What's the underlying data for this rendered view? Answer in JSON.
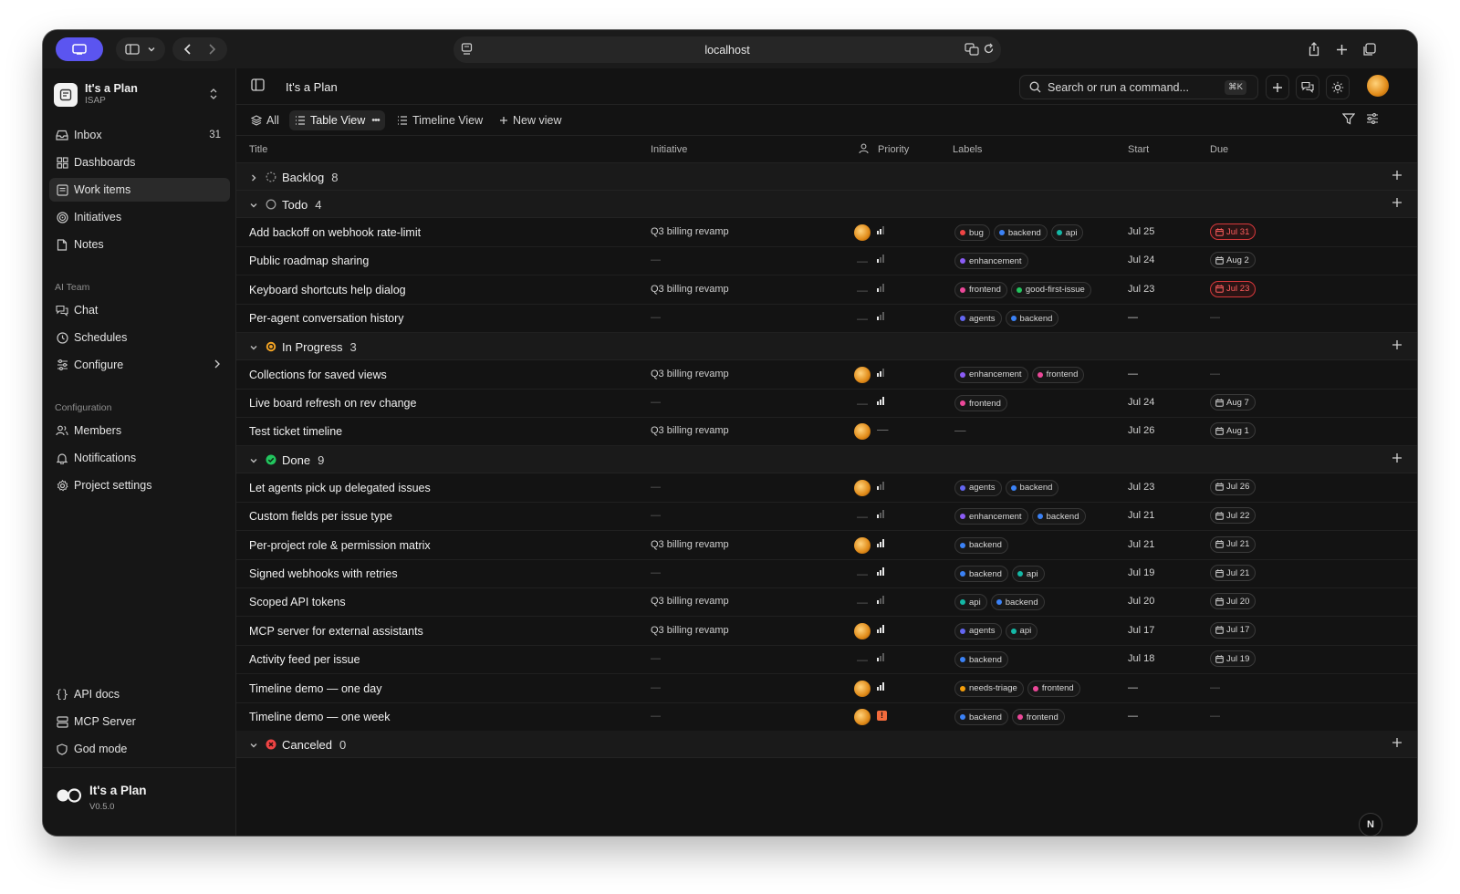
{
  "browser": {
    "url": "localhost"
  },
  "sidebar": {
    "workspace": {
      "name": "It's a Plan",
      "code": "ISAP"
    },
    "nav": [
      {
        "label": "Inbox",
        "count": "31",
        "icon": "inbox-icon"
      },
      {
        "label": "Dashboards",
        "icon": "dashboard-icon"
      },
      {
        "label": "Work items",
        "icon": "work-items-icon",
        "active": true
      },
      {
        "label": "Initiatives",
        "icon": "target-icon"
      },
      {
        "label": "Notes",
        "icon": "note-icon"
      }
    ],
    "ai_team": {
      "heading": "AI Team",
      "items": [
        {
          "label": "Chat",
          "icon": "chat-icon"
        },
        {
          "label": "Schedules",
          "icon": "clock-icon"
        },
        {
          "label": "Configure",
          "icon": "sliders-icon"
        }
      ]
    },
    "configuration": {
      "heading": "Configuration",
      "items": [
        {
          "label": "Members",
          "icon": "members-icon"
        },
        {
          "label": "Notifications",
          "icon": "bell-icon"
        },
        {
          "label": "Project settings",
          "icon": "gear-icon"
        }
      ]
    },
    "bottom": [
      {
        "label": "API docs",
        "icon": "braces-icon"
      },
      {
        "label": "MCP Server",
        "icon": "server-icon"
      },
      {
        "label": "God mode",
        "icon": "shield-icon"
      }
    ],
    "footer": {
      "app": "It's a Plan",
      "version": "V0.5.0"
    }
  },
  "header": {
    "title": "It's a Plan",
    "search_placeholder": "Search or run a command...",
    "search_shortcut": "⌘K"
  },
  "views": {
    "all": "All",
    "table": "Table View",
    "timeline": "Timeline View",
    "new": "New view"
  },
  "columns": {
    "title": "Title",
    "initiative": "Initiative",
    "priority": "Priority",
    "labels": "Labels",
    "start": "Start",
    "due": "Due"
  },
  "colors": {
    "accent": "#6b5cff",
    "overdue": "#ff5d5d",
    "in_progress": "#f5a524",
    "done": "#22c55e",
    "canceled": "#ef4444"
  },
  "label_colors": {
    "bug": "#ef4444",
    "backend": "#3b82f6",
    "api": "#14b8a6",
    "enhancement": "#8b5cf6",
    "frontend": "#ec4899",
    "good-first-issue": "#22c55e",
    "agents": "#6366f1",
    "needs-triage": "#f59e0b"
  },
  "groups": [
    {
      "name": "Backlog",
      "count": "8",
      "collapsed": true,
      "status": "backlog",
      "rows": []
    },
    {
      "name": "Todo",
      "count": "4",
      "collapsed": false,
      "status": "todo",
      "rows": [
        {
          "title": "Add backoff on webhook rate-limit",
          "initiative": "Q3 billing revamp",
          "assignee": true,
          "priority": 2,
          "labels": [
            "bug",
            "backend",
            "api"
          ],
          "start": "Jul 25",
          "due": "Jul 31",
          "overdue": true
        },
        {
          "title": "Public roadmap sharing",
          "initiative": "—",
          "assignee": false,
          "priority": 1,
          "labels": [
            "enhancement"
          ],
          "start": "Jul 24",
          "due": "Aug 2",
          "overdue": false
        },
        {
          "title": "Keyboard shortcuts help dialog",
          "initiative": "Q3 billing revamp",
          "assignee": false,
          "priority": 1,
          "labels": [
            "frontend",
            "good-first-issue"
          ],
          "start": "Jul 23",
          "due": "Jul 23",
          "overdue": true
        },
        {
          "title": "Per-agent conversation history",
          "initiative": "—",
          "assignee": false,
          "priority": 1,
          "labels": [
            "agents",
            "backend"
          ],
          "start": "—",
          "due": "—",
          "overdue": false
        }
      ]
    },
    {
      "name": "In Progress",
      "count": "3",
      "collapsed": false,
      "status": "in_progress",
      "rows": [
        {
          "title": "Collections for saved views",
          "initiative": "Q3 billing revamp",
          "assignee": true,
          "priority": 2,
          "labels": [
            "enhancement",
            "frontend"
          ],
          "start": "—",
          "due": "—",
          "overdue": false
        },
        {
          "title": "Live board refresh on rev change",
          "initiative": "—",
          "assignee": false,
          "priority": 3,
          "labels": [
            "frontend"
          ],
          "start": "Jul 24",
          "due": "Aug 7",
          "overdue": false
        },
        {
          "title": "Test ticket timeline",
          "initiative": "Q3 billing revamp",
          "assignee": true,
          "priority": 0,
          "labels": [],
          "start": "Jul 26",
          "due": "Aug 1",
          "overdue": false
        }
      ]
    },
    {
      "name": "Done",
      "count": "9",
      "collapsed": false,
      "status": "done",
      "rows": [
        {
          "title": "Let agents pick up delegated issues",
          "initiative": "—",
          "assignee": true,
          "priority": 1,
          "labels": [
            "agents",
            "backend"
          ],
          "start": "Jul 23",
          "due": "Jul 26",
          "overdue": false
        },
        {
          "title": "Custom fields per issue type",
          "initiative": "—",
          "assignee": false,
          "priority": 1,
          "labels": [
            "enhancement",
            "backend"
          ],
          "start": "Jul 21",
          "due": "Jul 22",
          "overdue": false
        },
        {
          "title": "Per-project role & permission matrix",
          "initiative": "Q3 billing revamp",
          "assignee": true,
          "priority": 3,
          "labels": [
            "backend"
          ],
          "start": "Jul 21",
          "due": "Jul 21",
          "overdue": false
        },
        {
          "title": "Signed webhooks with retries",
          "initiative": "—",
          "assignee": false,
          "priority": 3,
          "labels": [
            "backend",
            "api"
          ],
          "start": "Jul 19",
          "due": "Jul 21",
          "overdue": false
        },
        {
          "title": "Scoped API tokens",
          "initiative": "Q3 billing revamp",
          "assignee": false,
          "priority": 1,
          "labels": [
            "api",
            "backend"
          ],
          "start": "Jul 20",
          "due": "Jul 20",
          "overdue": false
        },
        {
          "title": "MCP server for external assistants",
          "initiative": "Q3 billing revamp",
          "assignee": true,
          "priority": 3,
          "labels": [
            "agents",
            "api"
          ],
          "start": "Jul 17",
          "due": "Jul 17",
          "overdue": false
        },
        {
          "title": "Activity feed per issue",
          "initiative": "—",
          "assignee": false,
          "priority": 1,
          "labels": [
            "backend"
          ],
          "start": "Jul 18",
          "due": "Jul 19",
          "overdue": false
        },
        {
          "title": "Timeline demo — one day",
          "initiative": "—",
          "assignee": true,
          "priority": 3,
          "labels": [
            "needs-triage",
            "frontend"
          ],
          "start": "—",
          "due": "—",
          "overdue": false
        },
        {
          "title": "Timeline demo — one week",
          "initiative": "—",
          "assignee": true,
          "priority": 4,
          "labels": [
            "backend",
            "frontend"
          ],
          "start": "—",
          "due": "—",
          "overdue": false
        }
      ]
    },
    {
      "name": "Canceled",
      "count": "0",
      "collapsed": false,
      "status": "canceled",
      "rows": []
    }
  ],
  "fab_label": "N"
}
